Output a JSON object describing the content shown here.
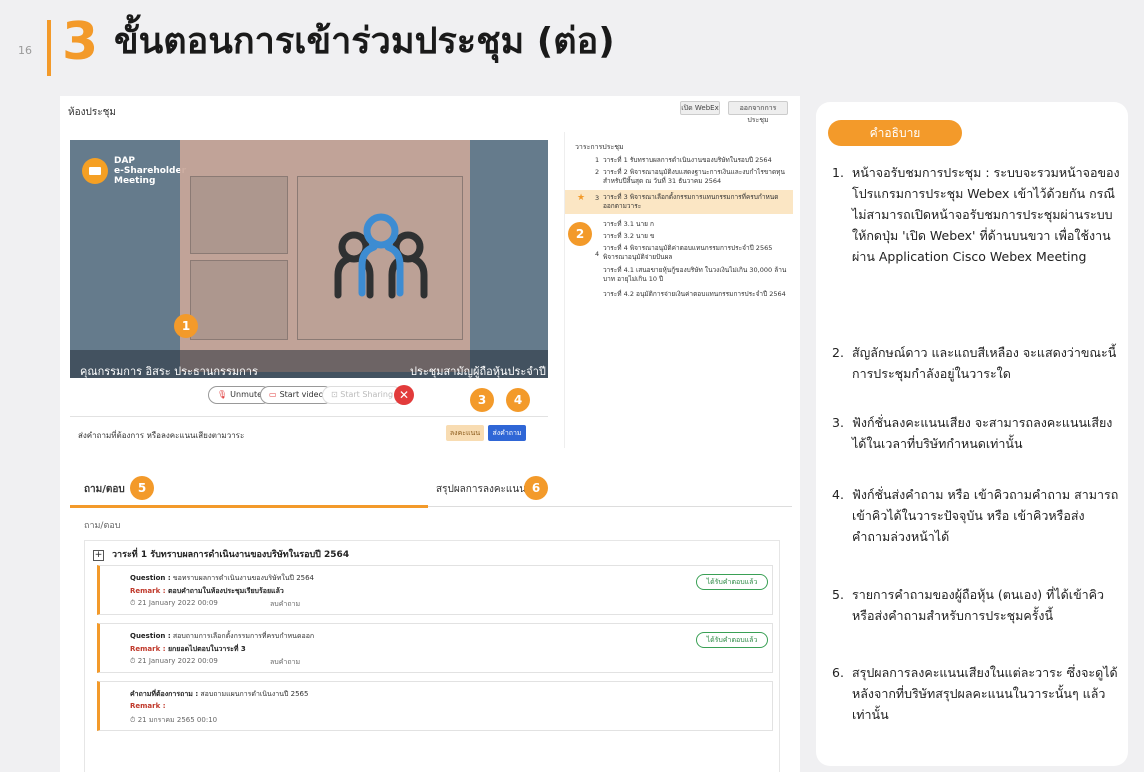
{
  "page_number": "16",
  "title": {
    "number": "3",
    "text": "ขั้นตอนการเข้าร่วมประชุม (ต่อ)"
  },
  "meeting": {
    "room_label": "ห้องประชุม",
    "top_buttons": [
      "เปิด WebEx",
      "ออกจากการประชุม"
    ],
    "video": {
      "logo_text": [
        "DAP",
        "e-Shareholder",
        "Meeting"
      ],
      "caption_left": "คุณกรรมการ อิสระ ประธานกรรมการ",
      "caption_right": "ประชุมสามัญผู้ถือหุ้นประจำปี 2564"
    },
    "controls": {
      "unmute": "Unmute",
      "start_video": "Start video",
      "start_sharing": "Start Sharing",
      "end": "✕"
    },
    "vote_bar": {
      "label": "ส่งคำถามที่ต้องการ หรือลงคะแนนเสียงตามวาระ",
      "vote_btn": "ลงคะแนน",
      "ask_btn": "ส่งคำถาม"
    },
    "agenda": {
      "title": "วาระการประชุม",
      "items": [
        {
          "num": "1",
          "text": "วาระที่ 1 รับทราบผลการดำเนินงานของบริษัทในรอบปี 2564"
        },
        {
          "num": "2",
          "text": "วาระที่ 2 พิจารณาอนุมัติงบแสดงฐานะการเงินและงบกำไรขาดทุนสำหรับปีสิ้นสุด ณ วันที่ 31 ธันวาคม 2564"
        },
        {
          "num": "3",
          "text": "วาระที่ 3 พิจารณาเลือกตั้งกรรมการแทนกรรมการที่ครบกำหนดออกตามวาระ"
        },
        {
          "num": "",
          "text": "วาระที่ 3.1 นาย ก"
        },
        {
          "num": "",
          "text": "วาระที่ 3.2 นาย ข"
        },
        {
          "num": "4",
          "text": "วาระที่ 4 พิจารณาอนุมัติค่าตอบแทนกรรมการประจำปี 2565 พิจารณาอนุมัติจ่ายปันผล"
        },
        {
          "num": "",
          "text": "วาระที่ 4.1 เสนอขายหุ้นกู้ของบริษัท ในวงเงินไม่เกิน 30,000 ล้านบาท อายุไม่เกิน 10 ปี"
        },
        {
          "num": "",
          "text": "วาระที่ 4.2 อนุมัติการจ่ายเงินค่าตอบแทนกรรมการประจำปี 2564"
        }
      ]
    },
    "qa": {
      "tab_qa": "ถาม/ตอบ",
      "tab_summary": "สรุปผลการลงคะแนน",
      "sub_label": "ถาม/ตอบ",
      "section_title": "วาระที่ 1 รับทราบผลการดำเนินงานของบริษัทในรอบปี 2564",
      "plus": "+",
      "cards": [
        {
          "q_label": "Question :",
          "question": "ขอทราบผลการดำเนินงานของบริษัทในปี 2564",
          "r_label": "Remark :",
          "remark": "ตอบคำถามในห้องประชุมเรียบร้อยแล้ว",
          "date": "21 January 2022 00:09",
          "status": "ลบคำถาม",
          "answered": "ได้รับคำตอบแล้ว"
        },
        {
          "q_label": "Question :",
          "question": "สอบถามการเลือกตั้งกรรมการที่ครบกำหนดออก",
          "r_label": "Remark :",
          "remark": "ยกยอดไปตอบในวาระที่ 3",
          "date": "21 January 2022 00:09",
          "status": "ลบคำถาม",
          "answered": "ได้รับคำตอบแล้ว"
        },
        {
          "q_label": "คำถามที่ต้องการถาม :",
          "question": "สอบถามแผนการดำเนินงานปี 2565",
          "r_label": "Remark :",
          "remark": "",
          "date": "21 มกราคม 2565 00:10",
          "status": "",
          "answered": ""
        }
      ]
    },
    "badges": [
      "1",
      "2",
      "3",
      "4",
      "5",
      "6"
    ]
  },
  "explanation": {
    "heading": "คำอธิบาย",
    "items": [
      {
        "num": "1.",
        "text": "หน้าจอรับชมการประชุม : ระบบจะรวมหน้าจอของโปรแกรมการประชุม Webex เข้าไว้ด้วยกัน กรณี ไม่สามารถเปิดหน้าจอรับชมการประชุมผ่านระบบให้กดปุ่ม 'เปิด Webex' ที่ด้านบนขวา เพื่อใช้งานผ่าน Application Cisco Webex Meeting"
      },
      {
        "num": "2.",
        "text": "สัญลักษณ์ดาว และแถบสีเหลือง จะแสดงว่าขณะนี้การประชุมกำลังอยู่ในวาระใด"
      },
      {
        "num": "3.",
        "text": "ฟังก์ชั่นลงคะแนนเสียง จะสามารถลงคะแนนเสียงได้ในเวลาที่บริษัทกำหนดเท่านั้น"
      },
      {
        "num": "4.",
        "text": "ฟังก์ชั่นส่งคำถาม หรือ เข้าคิวถามคำถาม สามารถเข้าคิวได้ในวาระปัจจุบัน หรือ เข้าคิวหรือส่งคำถามล่วงหน้าได้"
      },
      {
        "num": "5.",
        "text": "รายการคำถามของผู้ถือหุ้น (ตนเอง) ที่ได้เข้าคิวหรือส่งคำถามสำหรับการประชุมครั้งนี้"
      },
      {
        "num": "6.",
        "text": "สรุปผลการลงคะแนนเสียงในแต่ละวาระ ซึ่งจะดูได้หลังจากที่บริษัทสรุปผลคะแนนในวาระนั้นๆ แล้วเท่านั้น"
      }
    ]
  },
  "colors": {
    "accent": "#f39a2a",
    "video_bg": "#657b8c",
    "blue_btn": "#2f66d6",
    "answered": "#3aa055"
  }
}
